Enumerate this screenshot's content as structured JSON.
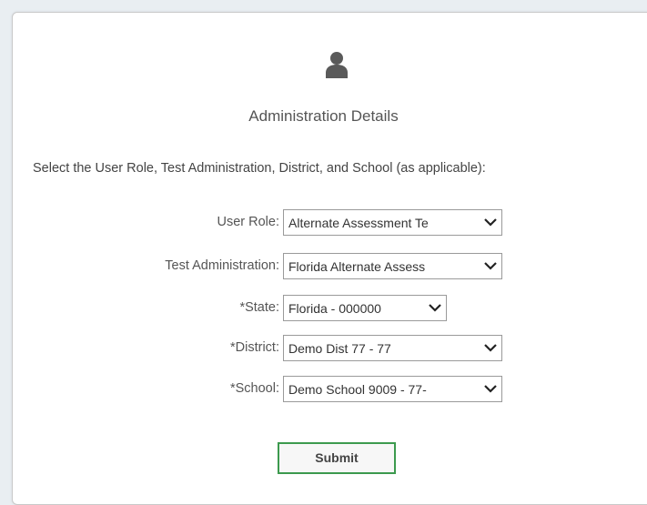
{
  "page": {
    "heading": "Administration Details",
    "instructions": "Select the User Role, Test Administration, District, and School (as applicable):"
  },
  "form": {
    "user_role": {
      "label": "User Role:",
      "value": "Alternate Assessment Te"
    },
    "test_administration": {
      "label": "Test Administration:",
      "value": "Florida Alternate Assess"
    },
    "state": {
      "label": "*State:",
      "value": "Florida - 000000"
    },
    "district": {
      "label": "*District:",
      "value": "Demo Dist 77 - 77"
    },
    "school": {
      "label": "*School:",
      "value": "Demo School 9009 - 77-"
    },
    "submit_label": "Submit"
  },
  "icons": {
    "user": "user-icon",
    "chevron": "chevron-down-icon"
  },
  "colors": {
    "submit_border": "#3c9a4e",
    "select_border": "#9a9a9a",
    "background": "#e9eef2"
  }
}
